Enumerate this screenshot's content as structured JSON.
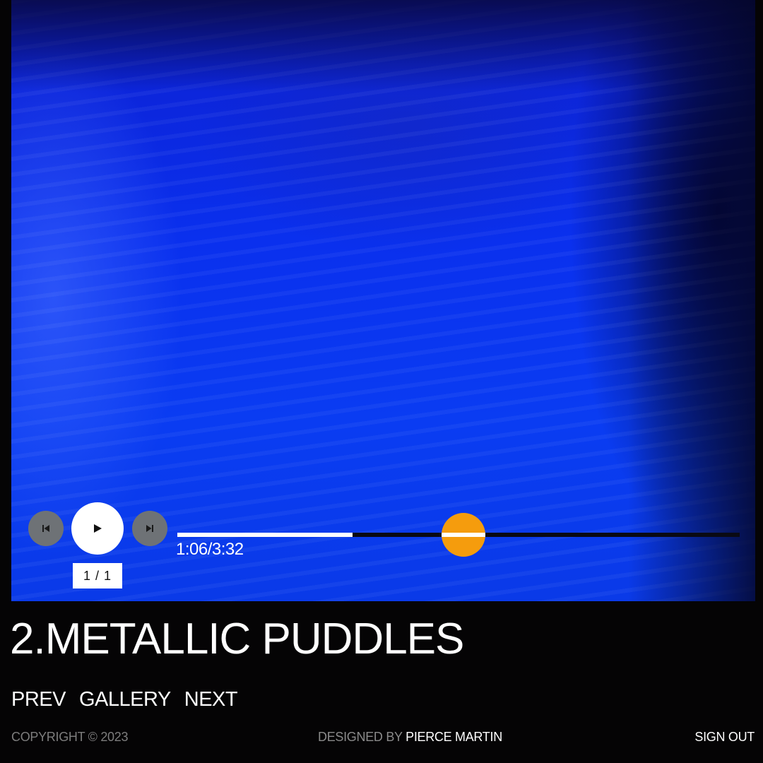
{
  "player": {
    "time_label": "1:06/3:32",
    "track_counter": "1 / 1",
    "progress_fraction": 0.311,
    "prev_icon": "skip-back-icon",
    "play_icon": "play-icon",
    "next_icon": "skip-forward-icon",
    "knob_color": "#f59c0d"
  },
  "song": {
    "title": "2.METALLIC PUDDLES"
  },
  "nav": {
    "prev": "PREV",
    "gallery": "GALLERY",
    "next": "NEXT"
  },
  "footer": {
    "copyright": "COPYRIGHT © 2023",
    "designed_prefix": "DESIGNED BY",
    "designer": "PIERCE MARTIN",
    "sign_out": "SIGN OUT"
  },
  "colors": {
    "background": "#050405",
    "media_blue": "#0a3cf2",
    "accent": "#f59c0d"
  }
}
